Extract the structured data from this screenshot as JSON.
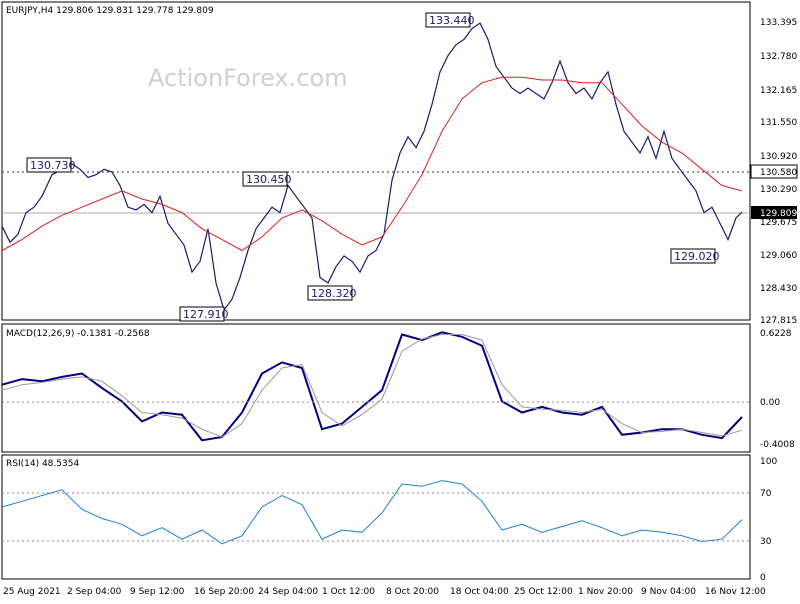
{
  "watermark": "ActionForex.com",
  "main_panel": {
    "caption": "EURJPY,H4  129.806 129.831 129.778 129.809",
    "y_ticks": [
      "133.395",
      "132.780",
      "132.165",
      "131.550",
      "130.920",
      "130.290",
      "129.675",
      "129.060",
      "128.430",
      "127.815"
    ],
    "level_labels": [
      {
        "text": "130.730"
      },
      {
        "text": "130.450"
      },
      {
        "text": "127.910"
      },
      {
        "text": "128.320"
      },
      {
        "text": "133.440"
      },
      {
        "text": "129.020"
      }
    ],
    "horizontal_lines": [
      {
        "value": 130.58,
        "label": "130.580",
        "style": "dotted"
      },
      {
        "value": 129.809,
        "label": "129.809",
        "style": "solid-gray"
      }
    ]
  },
  "macd_panel": {
    "caption": "MACD(12,26,9) -0.1381 -0.2568",
    "y_ticks": [
      "0.6228",
      "0.00",
      "-0.4008"
    ]
  },
  "rsi_panel": {
    "caption": "RSI(14) 48.5354",
    "y_ticks": [
      "100",
      "70",
      "30",
      "0"
    ]
  },
  "x_axis_labels": [
    "25 Aug 2021",
    "2 Sep 04:00",
    "9 Sep 12:00",
    "16 Sep 20:00",
    "24 Sep 04:00",
    "1 Oct 12:00",
    "8 Oct 20:00",
    "18 Oct 04:00",
    "25 Oct 12:00",
    "1 Nov 20:00",
    "9 Nov 04:00",
    "16 Nov 12:00"
  ],
  "chart_data": [
    {
      "type": "line",
      "title": "EURJPY,H4",
      "note": "price bars approximated as close series; red line is moving average",
      "ylim": [
        127.815,
        133.395
      ],
      "series": [
        {
          "name": "",
          "color": "#1a1a6e",
          "points": [
            [
              0,
              129.55
            ],
            [
              8,
              129.25
            ],
            [
              16,
              129.4
            ],
            [
              24,
              129.8
            ],
            [
              32,
              129.9
            ],
            [
              40,
              130.1
            ],
            [
              50,
              130.5
            ],
            [
              60,
              130.6
            ],
            [
              70,
              130.7
            ],
            [
              78,
              130.6
            ],
            [
              86,
              130.45
            ],
            [
              94,
              130.5
            ],
            [
              102,
              130.6
            ],
            [
              110,
              130.55
            ],
            [
              118,
              130.3
            ],
            [
              126,
              129.9
            ],
            [
              134,
              129.85
            ],
            [
              142,
              129.95
            ],
            [
              150,
              129.8
            ],
            [
              158,
              130.1
            ],
            [
              166,
              129.6
            ],
            [
              174,
              129.4
            ],
            [
              182,
              129.2
            ],
            [
              190,
              128.7
            ],
            [
              198,
              128.9
            ],
            [
              206,
              129.5
            ],
            [
              214,
              128.5
            ],
            [
              222,
              128.0
            ],
            [
              230,
              128.2
            ],
            [
              238,
              128.6
            ],
            [
              246,
              129.1
            ],
            [
              254,
              129.5
            ],
            [
              262,
              129.7
            ],
            [
              270,
              129.9
            ],
            [
              278,
              129.8
            ],
            [
              286,
              130.3
            ],
            [
              294,
              130.1
            ],
            [
              302,
              129.9
            ],
            [
              310,
              129.7
            ],
            [
              318,
              128.6
            ],
            [
              326,
              128.5
            ],
            [
              334,
              128.8
            ],
            [
              342,
              129.0
            ],
            [
              350,
              128.9
            ],
            [
              358,
              128.7
            ],
            [
              366,
              129.0
            ],
            [
              374,
              129.1
            ],
            [
              382,
              129.4
            ],
            [
              390,
              130.4
            ],
            [
              398,
              130.9
            ],
            [
              406,
              131.2
            ],
            [
              414,
              131.0
            ],
            [
              422,
              131.3
            ],
            [
              430,
              131.8
            ],
            [
              438,
              132.4
            ],
            [
              446,
              132.7
            ],
            [
              454,
              132.9
            ],
            [
              462,
              133.0
            ],
            [
              470,
              133.2
            ],
            [
              478,
              133.3
            ],
            [
              486,
              133.0
            ],
            [
              494,
              132.5
            ],
            [
              502,
              132.3
            ],
            [
              510,
              132.1
            ],
            [
              518,
              132.0
            ],
            [
              526,
              132.1
            ],
            [
              534,
              132.0
            ],
            [
              542,
              131.9
            ],
            [
              550,
              132.2
            ],
            [
              558,
              132.6
            ],
            [
              566,
              132.2
            ],
            [
              574,
              132.0
            ],
            [
              582,
              132.1
            ],
            [
              590,
              131.9
            ],
            [
              598,
              132.2
            ],
            [
              606,
              132.4
            ],
            [
              614,
              131.8
            ],
            [
              622,
              131.3
            ],
            [
              630,
              131.1
            ],
            [
              638,
              130.9
            ],
            [
              646,
              131.2
            ],
            [
              654,
              130.8
            ],
            [
              662,
              131.3
            ],
            [
              670,
              130.8
            ],
            [
              678,
              130.6
            ],
            [
              686,
              130.4
            ],
            [
              694,
              130.2
            ],
            [
              702,
              129.8
            ],
            [
              710,
              129.9
            ],
            [
              718,
              129.6
            ],
            [
              726,
              129.3
            ],
            [
              734,
              129.7
            ],
            [
              740,
              129.81
            ]
          ]
        },
        {
          "name": "",
          "color": "#d62020",
          "points": [
            [
              0,
              129.1
            ],
            [
              20,
              129.3
            ],
            [
              40,
              129.55
            ],
            [
              60,
              129.75
            ],
            [
              80,
              129.9
            ],
            [
              100,
              130.05
            ],
            [
              120,
              130.2
            ],
            [
              140,
              130.05
            ],
            [
              160,
              129.95
            ],
            [
              180,
              129.8
            ],
            [
              200,
              129.5
            ],
            [
              220,
              129.3
            ],
            [
              240,
              129.1
            ],
            [
              260,
              129.35
            ],
            [
              280,
              129.7
            ],
            [
              300,
              129.85
            ],
            [
              320,
              129.65
            ],
            [
              340,
              129.4
            ],
            [
              360,
              129.2
            ],
            [
              380,
              129.35
            ],
            [
              400,
              129.9
            ],
            [
              420,
              130.5
            ],
            [
              440,
              131.3
            ],
            [
              460,
              131.9
            ],
            [
              480,
              132.2
            ],
            [
              500,
              132.3
            ],
            [
              520,
              132.3
            ],
            [
              540,
              132.25
            ],
            [
              560,
              132.25
            ],
            [
              580,
              132.2
            ],
            [
              600,
              132.2
            ],
            [
              620,
              131.8
            ],
            [
              640,
              131.4
            ],
            [
              660,
              131.1
            ],
            [
              680,
              130.9
            ],
            [
              700,
              130.6
            ],
            [
              720,
              130.3
            ],
            [
              740,
              130.2
            ]
          ]
        }
      ]
    },
    {
      "type": "line",
      "title": "MACD(12,26,9)",
      "ylim": [
        -0.4008,
        0.6228
      ],
      "series": [
        {
          "name": "",
          "color": "#000080",
          "points": [
            [
              0,
              0.15
            ],
            [
              20,
              0.2
            ],
            [
              40,
              0.18
            ],
            [
              60,
              0.22
            ],
            [
              80,
              0.25
            ],
            [
              100,
              0.12
            ],
            [
              120,
              0.0
            ],
            [
              140,
              -0.18
            ],
            [
              160,
              -0.1
            ],
            [
              180,
              -0.12
            ],
            [
              200,
              -0.35
            ],
            [
              220,
              -0.32
            ],
            [
              240,
              -0.1
            ],
            [
              260,
              0.25
            ],
            [
              280,
              0.35
            ],
            [
              300,
              0.3
            ],
            [
              320,
              -0.25
            ],
            [
              340,
              -0.2
            ],
            [
              360,
              -0.05
            ],
            [
              380,
              0.1
            ],
            [
              400,
              0.6
            ],
            [
              420,
              0.55
            ],
            [
              440,
              0.62
            ],
            [
              460,
              0.58
            ],
            [
              480,
              0.5
            ],
            [
              500,
              0.0
            ],
            [
              520,
              -0.1
            ],
            [
              540,
              -0.05
            ],
            [
              560,
              -0.1
            ],
            [
              580,
              -0.12
            ],
            [
              600,
              -0.05
            ],
            [
              620,
              -0.3
            ],
            [
              640,
              -0.28
            ],
            [
              660,
              -0.25
            ],
            [
              680,
              -0.25
            ],
            [
              700,
              -0.3
            ],
            [
              720,
              -0.33
            ],
            [
              740,
              -0.14
            ]
          ]
        },
        {
          "name": "",
          "color": "#999999",
          "points": [
            [
              0,
              0.1
            ],
            [
              20,
              0.15
            ],
            [
              40,
              0.17
            ],
            [
              60,
              0.2
            ],
            [
              80,
              0.22
            ],
            [
              100,
              0.18
            ],
            [
              120,
              0.05
            ],
            [
              140,
              -0.1
            ],
            [
              160,
              -0.12
            ],
            [
              180,
              -0.15
            ],
            [
              200,
              -0.25
            ],
            [
              220,
              -0.32
            ],
            [
              240,
              -0.2
            ],
            [
              260,
              0.1
            ],
            [
              280,
              0.3
            ],
            [
              300,
              0.33
            ],
            [
              320,
              -0.1
            ],
            [
              340,
              -0.22
            ],
            [
              360,
              -0.12
            ],
            [
              380,
              0.02
            ],
            [
              400,
              0.45
            ],
            [
              420,
              0.56
            ],
            [
              440,
              0.6
            ],
            [
              460,
              0.6
            ],
            [
              480,
              0.55
            ],
            [
              500,
              0.15
            ],
            [
              520,
              -0.05
            ],
            [
              540,
              -0.07
            ],
            [
              560,
              -0.08
            ],
            [
              580,
              -0.1
            ],
            [
              600,
              -0.07
            ],
            [
              620,
              -0.2
            ],
            [
              640,
              -0.28
            ],
            [
              660,
              -0.27
            ],
            [
              680,
              -0.25
            ],
            [
              700,
              -0.28
            ],
            [
              720,
              -0.31
            ],
            [
              740,
              -0.26
            ]
          ]
        }
      ]
    },
    {
      "type": "line",
      "title": "RSI(14)",
      "ylim": [
        0,
        100
      ],
      "series": [
        {
          "name": "",
          "color": "#1e7fd8",
          "points": [
            [
              0,
              60
            ],
            [
              20,
              65
            ],
            [
              40,
              70
            ],
            [
              60,
              75
            ],
            [
              80,
              58
            ],
            [
              100,
              50
            ],
            [
              120,
              45
            ],
            [
              140,
              35
            ],
            [
              160,
              42
            ],
            [
              180,
              32
            ],
            [
              200,
              40
            ],
            [
              220,
              28
            ],
            [
              240,
              35
            ],
            [
              260,
              60
            ],
            [
              280,
              70
            ],
            [
              300,
              62
            ],
            [
              320,
              32
            ],
            [
              340,
              40
            ],
            [
              360,
              38
            ],
            [
              380,
              55
            ],
            [
              400,
              80
            ],
            [
              420,
              78
            ],
            [
              440,
              83
            ],
            [
              460,
              80
            ],
            [
              480,
              65
            ],
            [
              500,
              40
            ],
            [
              520,
              45
            ],
            [
              540,
              38
            ],
            [
              560,
              43
            ],
            [
              580,
              48
            ],
            [
              600,
              42
            ],
            [
              620,
              35
            ],
            [
              640,
              40
            ],
            [
              660,
              38
            ],
            [
              680,
              35
            ],
            [
              700,
              30
            ],
            [
              720,
              32
            ],
            [
              740,
              49
            ]
          ]
        }
      ]
    }
  ]
}
